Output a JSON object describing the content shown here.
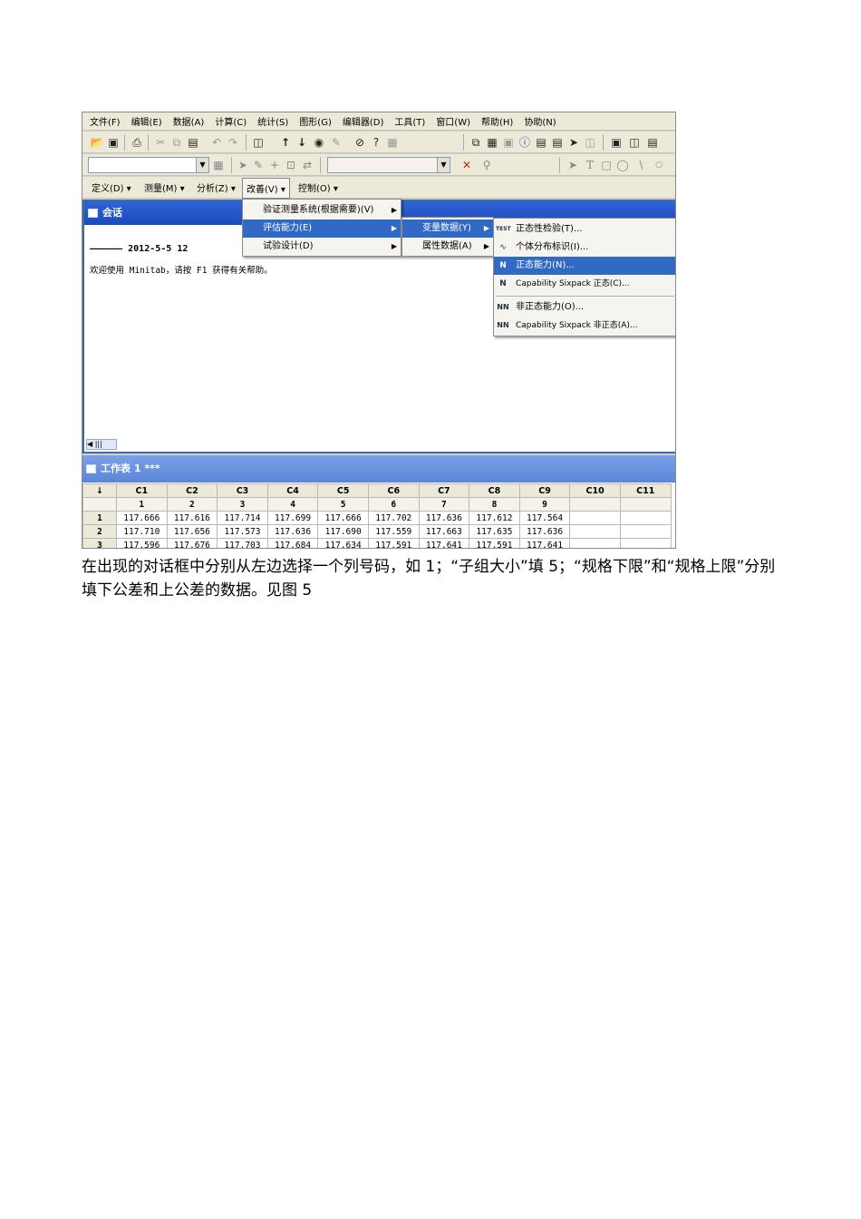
{
  "menubar": [
    "文件(F)",
    "编辑(E)",
    "数据(A)",
    "计算(C)",
    "统计(S)",
    "图形(G)",
    "编辑器(D)",
    "工具(T)",
    "窗口(W)",
    "帮助(H)",
    "协助(N)"
  ],
  "subtoolbar": [
    "定义(D) ▾",
    "测量(M) ▾",
    "分析(Z) ▾",
    "改善(V) ▾",
    "控制(O) ▾"
  ],
  "session": {
    "title": "会话",
    "line1": "——————    2012-5-5 12",
    "line2": "欢迎使用 Minitab，请按 F1 获得有关帮助。"
  },
  "worksheet": {
    "title": "工作表 1 ***",
    "columns": [
      "↓",
      "C1",
      "C2",
      "C3",
      "C4",
      "C5",
      "C6",
      "C7",
      "C8",
      "C9",
      "C10",
      "C11"
    ],
    "names": [
      "",
      "1",
      "2",
      "3",
      "4",
      "5",
      "6",
      "7",
      "8",
      "9",
      "",
      ""
    ],
    "rows": [
      [
        "1",
        "117.666",
        "117.616",
        "117.714",
        "117.699",
        "117.666",
        "117.702",
        "117.636",
        "117.612",
        "117.564",
        "",
        ""
      ],
      [
        "2",
        "117.710",
        "117.656",
        "117.573",
        "117.636",
        "117.690",
        "117.559",
        "117.663",
        "117.635",
        "117.636",
        "",
        ""
      ],
      [
        "3",
        "117.596",
        "117.676",
        "117.703",
        "117.684",
        "117.634",
        "117.591",
        "117.641",
        "117.591",
        "117.641",
        "",
        ""
      ]
    ]
  },
  "menu_improve": [
    "验证测量系统(根据需要)(V)",
    "评估能力(E)",
    "试验设计(D)"
  ],
  "menu_capability": [
    "变量数据(Y)",
    "属性数据(A)"
  ],
  "menu_variable": [
    {
      "icon": "TEST",
      "label": "正态性检验(T)..."
    },
    {
      "icon": "",
      "label": "个体分布标识(I)..."
    },
    {
      "icon": "N",
      "label": "正态能力(N)..."
    },
    {
      "icon": "N",
      "label": "Capability Sixpack 正态(C)..."
    },
    {
      "icon": "NN",
      "label": "非正态能力(O)..."
    },
    {
      "icon": "NN",
      "label": "Capability Sixpack 非正态(A)..."
    }
  ],
  "caption": "在出现的对话框中分别从左边选择一个列号码，如 1；“子组大小”填 5；“规格下限”和“规格上限”分别填下公差和上公差的数据。见图 5"
}
